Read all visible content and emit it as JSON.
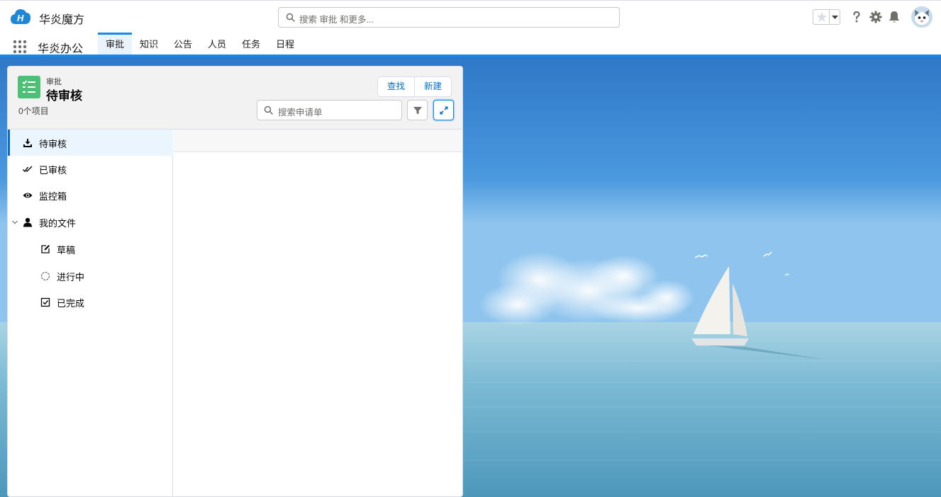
{
  "header": {
    "brand": "华炎魔方",
    "search_placeholder": "搜索 审批 和更多..."
  },
  "nav": {
    "app_name": "华炎办公",
    "tabs": [
      {
        "label": "审批",
        "active": true
      },
      {
        "label": "知识",
        "active": false
      },
      {
        "label": "公告",
        "active": false
      },
      {
        "label": "人员",
        "active": false
      },
      {
        "label": "任务",
        "active": false
      },
      {
        "label": "日程",
        "active": false
      }
    ]
  },
  "list": {
    "object_label": "审批",
    "title": "待审核",
    "count": "0个项目",
    "find_button": "查找",
    "new_button": "新建",
    "search_placeholder": "搜索申请单"
  },
  "sidenav": {
    "items": [
      {
        "label": "待审核",
        "icon": "download-icon",
        "active": true
      },
      {
        "label": "已审核",
        "icon": "double-check-icon"
      },
      {
        "label": "监控箱",
        "icon": "eye-icon"
      },
      {
        "label": "我的文件",
        "icon": "user-icon",
        "expanded": true
      },
      {
        "label": "草稿",
        "icon": "edit-icon"
      },
      {
        "label": "进行中",
        "icon": "spinner-icon"
      },
      {
        "label": "已完成",
        "icon": "checkbox-icon"
      }
    ]
  },
  "colors": {
    "accent": "#1589ee",
    "link": "#0070d2",
    "object_icon": "#4bc076"
  }
}
